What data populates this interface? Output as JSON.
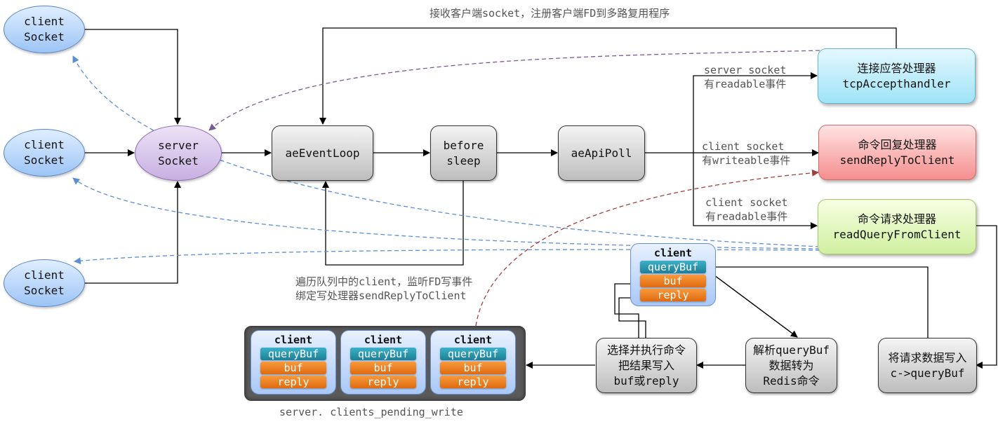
{
  "colors": {
    "client_socket_fill": "#9cc4f5",
    "server_socket_fill": "#c7b0e2",
    "gray_box_fill": "#bdbdbd",
    "accept_handler_fill": "#9fe3f7",
    "reply_handler_fill": "#f58e8e",
    "read_handler_fill": "#d0f0a0",
    "querybuf_fill": "#1f7f96",
    "buf_fill": "#e06a10",
    "queue_fill": "#5a5a5a",
    "blue_dashed": "#5b8fd6",
    "purple_dashed": "#7a5a96",
    "red_dashed": "#a04040"
  },
  "client_sockets": [
    {
      "line1": "client",
      "line2": "Socket"
    },
    {
      "line1": "client",
      "line2": "Socket"
    },
    {
      "line1": "client",
      "line2": "Socket"
    }
  ],
  "server_socket": {
    "line1": "server",
    "line2": "Socket"
  },
  "loop": {
    "event_loop": "aeEventLoop",
    "before_sleep": {
      "line1": "before",
      "line2": "sleep"
    },
    "api_poll": "aeApiPoll"
  },
  "handlers": {
    "accept": {
      "title": "连接应答处理器",
      "name": "tcpAccepthandler"
    },
    "reply": {
      "title": "命令回复处理器",
      "name": "sendReplyToClient"
    },
    "read": {
      "title": "命令请求处理器",
      "name": "readQueryFromClient"
    }
  },
  "event_labels": {
    "server_readable": {
      "line1": "server socket",
      "line2": "有readable事件"
    },
    "client_writeable": {
      "line1": "client socket",
      "line2": "有writeable事件"
    },
    "client_readable": {
      "line1": "client socket",
      "line2": "有readable事件"
    }
  },
  "annotations": {
    "accept_loop": "接收客户端socket，注册客户端FD到多路复用程序",
    "before_sleep_line1": "遍历队列中的client，监听FD写事件",
    "before_sleep_line2": "绑定写处理器sendReplyToClient",
    "queue_caption": "server. clients_pending_write"
  },
  "client_struct": {
    "title": "client",
    "fields": [
      "queryBuf",
      "buf",
      "reply"
    ]
  },
  "pending_clients": [
    {
      "title": "client",
      "fields": [
        "queryBuf",
        "buf",
        "reply"
      ]
    },
    {
      "title": "client",
      "fields": [
        "queryBuf",
        "buf",
        "reply"
      ]
    },
    {
      "title": "client",
      "fields": [
        "queryBuf",
        "buf",
        "reply"
      ]
    }
  ],
  "steps": {
    "write_querybuf": {
      "line1": "将请求数据写入",
      "line2": "c->queryBuf"
    },
    "parse": {
      "line1": "解析queryBuf",
      "line2": "数据转为",
      "line3": "Redis命令"
    },
    "execute": {
      "line1": "选择并执行命令",
      "line2": "把结果写入",
      "line3": "buf或reply"
    }
  }
}
